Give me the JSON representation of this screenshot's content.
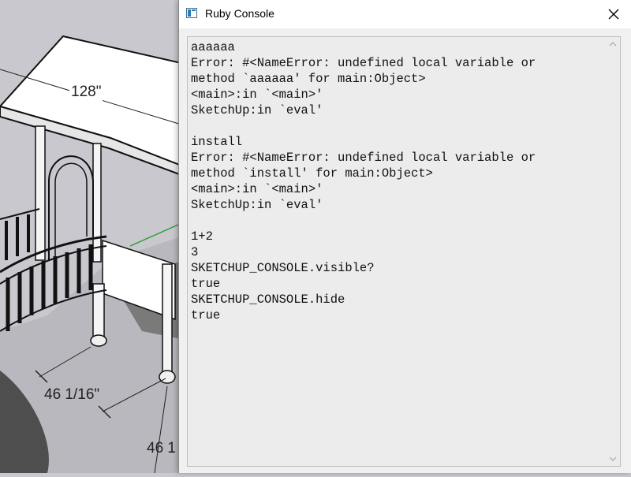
{
  "window": {
    "title": "Ruby Console"
  },
  "model": {
    "dimensions": [
      "128\"",
      "46 1/16\"",
      "46 1"
    ]
  },
  "console": {
    "lines": [
      "aaaaaa",
      "Error: #<NameError: undefined local variable or",
      "method `aaaaaa' for main:Object>",
      "<main>:in `<main>'",
      "SketchUp:in `eval'",
      "",
      "install",
      "Error: #<NameError: undefined local variable or",
      "method `install' for main:Object>",
      "<main>:in `<main>'",
      "SketchUp:in `eval'",
      "",
      "1+2",
      "3",
      "SKETCHUP_CONSOLE.visible?",
      "true",
      "SKETCHUP_CONSOLE.hide",
      "true"
    ]
  },
  "icons": {
    "app": "ruby-console-app-icon",
    "close": "close-icon",
    "scroll_up": "chevron-up-icon",
    "scroll_down": "chevron-down-icon"
  }
}
